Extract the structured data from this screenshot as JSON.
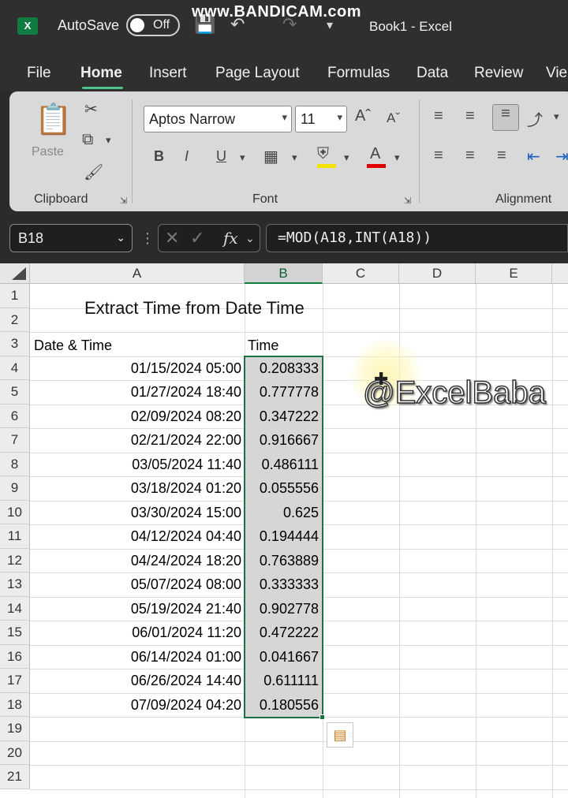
{
  "titlebar": {
    "autosave_label": "AutoSave",
    "autosave_state": "Off",
    "watermark": "www.BANDICAM.com",
    "book_title": "Book1  -  Excel"
  },
  "menu": {
    "tabs": [
      "File",
      "Home",
      "Insert",
      "Page Layout",
      "Formulas",
      "Data",
      "Review",
      "Vie"
    ],
    "active": "Home"
  },
  "ribbon": {
    "clipboard_label": "Clipboard",
    "paste_label": "Paste",
    "font_label": "Font",
    "alignment_label": "Alignment",
    "font_name": "Aptos Narrow",
    "font_size": "11",
    "bold": "B",
    "italic": "I",
    "underline": "U",
    "font_color_accent": "#e00000",
    "highlight_accent": "#f5e100"
  },
  "formula_bar": {
    "name_box": "B18",
    "fx": "fx",
    "formula": "=MOD(A18,INT(A18))"
  },
  "sheet": {
    "columns": [
      "A",
      "B",
      "C",
      "D",
      "E"
    ],
    "rows": [
      "1",
      "2",
      "3",
      "4",
      "5",
      "6",
      "7",
      "8",
      "9",
      "10",
      "11",
      "12",
      "13",
      "14",
      "15",
      "16",
      "17",
      "18",
      "19",
      "20",
      "21"
    ],
    "title": "Extract Time from Date Time",
    "header_a": "Date & Time",
    "header_b": "Time",
    "data": [
      {
        "dt": "01/15/2024 05:00",
        "t": "0.208333"
      },
      {
        "dt": "01/27/2024 18:40",
        "t": "0.777778"
      },
      {
        "dt": "02/09/2024 08:20",
        "t": "0.347222"
      },
      {
        "dt": "02/21/2024 22:00",
        "t": "0.916667"
      },
      {
        "dt": "03/05/2024 11:40",
        "t": "0.486111"
      },
      {
        "dt": "03/18/2024 01:20",
        "t": "0.055556"
      },
      {
        "dt": "03/30/2024 15:00",
        "t": "0.625"
      },
      {
        "dt": "04/12/2024 04:40",
        "t": "0.194444"
      },
      {
        "dt": "04/24/2024 18:20",
        "t": "0.763889"
      },
      {
        "dt": "05/07/2024 08:00",
        "t": "0.333333"
      },
      {
        "dt": "05/19/2024 21:40",
        "t": "0.902778"
      },
      {
        "dt": "06/01/2024 11:20",
        "t": "0.472222"
      },
      {
        "dt": "06/14/2024 01:00",
        "t": "0.041667"
      },
      {
        "dt": "06/26/2024 14:40",
        "t": "0.611111"
      },
      {
        "dt": "07/09/2024 04:20",
        "t": "0.180556"
      }
    ],
    "overlay_watermark": "@ExcelBaba",
    "accent": "#107c41"
  }
}
